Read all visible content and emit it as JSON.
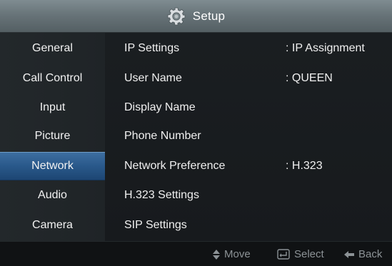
{
  "header": {
    "title": "Setup",
    "icon": "gear-icon"
  },
  "sidebar": {
    "items": [
      {
        "label": "General"
      },
      {
        "label": "Call Control"
      },
      {
        "label": "Input"
      },
      {
        "label": "Picture"
      },
      {
        "label": "Network",
        "selected": true
      },
      {
        "label": "Audio"
      },
      {
        "label": "Camera"
      }
    ]
  },
  "settings": {
    "rows": [
      {
        "label": "IP Settings",
        "value": ": IP Assignment"
      },
      {
        "label": "User Name",
        "value": ": QUEEN"
      },
      {
        "label": "Display Name",
        "value": ""
      },
      {
        "label": "Phone Number",
        "value": ""
      },
      {
        "label": "Network Preference",
        "value": ": H.323"
      },
      {
        "label": "H.323 Settings",
        "value": ""
      },
      {
        "label": "SIP Settings",
        "value": ""
      }
    ]
  },
  "footer": {
    "move_label": "Move",
    "select_label": "Select",
    "back_label": "Back",
    "icons": [
      "up-down-arrows-icon",
      "enter-key-icon",
      "back-arrow-icon"
    ]
  },
  "colors": {
    "selected_item": "#2c5c8f",
    "title_bar": "#6a767b",
    "footer_text": "#8c9296"
  }
}
